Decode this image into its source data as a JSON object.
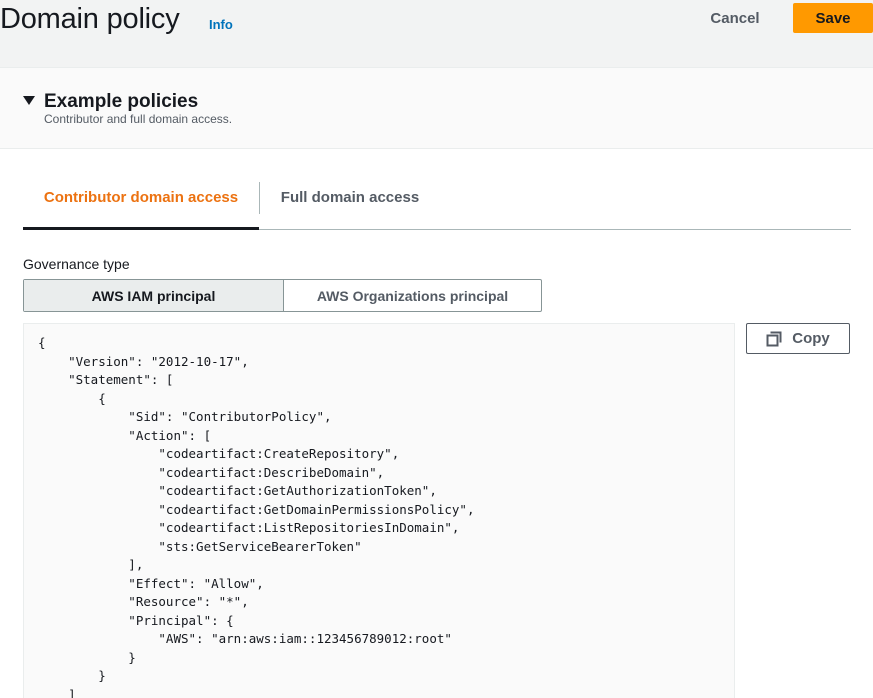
{
  "header": {
    "title": "Domain policy",
    "info_label": "Info",
    "cancel_label": "Cancel",
    "save_label": "Save"
  },
  "example_policies": {
    "title": "Example policies",
    "subtitle": "Contributor and full domain access.",
    "expanded": true
  },
  "tabs": [
    {
      "label": "Contributor domain access",
      "active": true
    },
    {
      "label": "Full domain access",
      "active": false
    }
  ],
  "governance": {
    "label": "Governance type",
    "options": [
      {
        "label": "AWS IAM principal",
        "selected": true
      },
      {
        "label": "AWS Organizations principal",
        "selected": false
      }
    ]
  },
  "policy": {
    "copy_label": "Copy",
    "code": "{\n    \"Version\": \"2012-10-17\",\n    \"Statement\": [\n        {\n            \"Sid\": \"ContributorPolicy\",\n            \"Action\": [\n                \"codeartifact:CreateRepository\",\n                \"codeartifact:DescribeDomain\",\n                \"codeartifact:GetAuthorizationToken\",\n                \"codeartifact:GetDomainPermissionsPolicy\",\n                \"codeartifact:ListRepositoriesInDomain\",\n                \"sts:GetServiceBearerToken\"\n            ],\n            \"Effect\": \"Allow\",\n            \"Resource\": \"*\",\n            \"Principal\": {\n                \"AWS\": \"arn:aws:iam::123456789012:root\"\n            }\n        }\n    ]\n}"
  },
  "colors": {
    "accent_orange": "#ff9900",
    "active_tab": "#ec7211",
    "link_blue": "#0073bb",
    "header_bg": "#f2f3f3"
  },
  "icons": {
    "caret": "caret-down-icon",
    "copy": "copy-icon"
  }
}
